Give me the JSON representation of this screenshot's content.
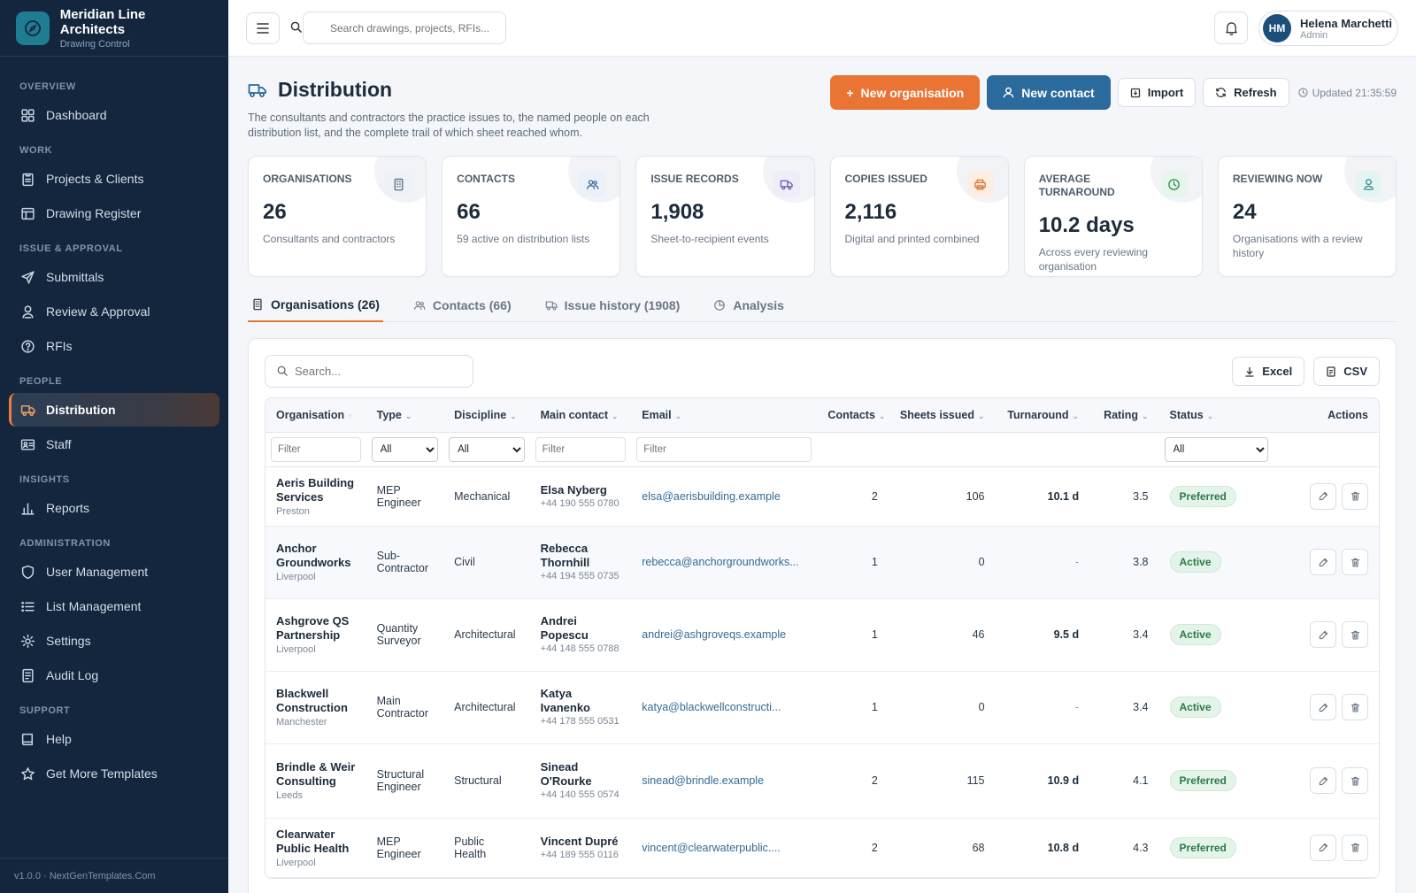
{
  "brand": {
    "title": "Meridian Line Architects",
    "subtitle": "Drawing Control"
  },
  "sidebar": {
    "sections": [
      {
        "label": "OVERVIEW",
        "items": [
          {
            "label": "Dashboard",
            "icon": "dashboard-icon"
          }
        ]
      },
      {
        "label": "WORK",
        "items": [
          {
            "label": "Projects & Clients",
            "icon": "clipboard-icon"
          },
          {
            "label": "Drawing Register",
            "icon": "register-icon"
          }
        ]
      },
      {
        "label": "ISSUE & APPROVAL",
        "items": [
          {
            "label": "Submittals",
            "icon": "send-icon"
          },
          {
            "label": "Review & Approval",
            "icon": "reviewer-icon"
          },
          {
            "label": "RFIs",
            "icon": "question-icon"
          }
        ]
      },
      {
        "label": "PEOPLE",
        "items": [
          {
            "label": "Distribution",
            "icon": "truck-icon",
            "active": true
          },
          {
            "label": "Staff",
            "icon": "id-card-icon"
          }
        ]
      },
      {
        "label": "INSIGHTS",
        "items": [
          {
            "label": "Reports",
            "icon": "bar-chart-icon"
          }
        ]
      },
      {
        "label": "ADMINISTRATION",
        "items": [
          {
            "label": "User Management",
            "icon": "shield-icon"
          },
          {
            "label": "List Management",
            "icon": "list-icon"
          },
          {
            "label": "Settings",
            "icon": "gear-icon"
          },
          {
            "label": "Audit Log",
            "icon": "log-icon"
          }
        ]
      },
      {
        "label": "SUPPORT",
        "items": [
          {
            "label": "Help",
            "icon": "book-icon"
          },
          {
            "label": "Get More Templates",
            "icon": "star-icon"
          }
        ]
      }
    ],
    "footer": "v1.0.0 · NextGenTemplates.Com"
  },
  "topbar": {
    "search_placeholder": "Search drawings, projects, RFIs...",
    "user": {
      "initials": "HM",
      "name": "Helena Marchetti",
      "role": "Admin"
    }
  },
  "page": {
    "title": "Distribution",
    "description": "The consultants and contractors the practice issues to, the named people on each distribution list, and the complete trail of which sheet reached whom.",
    "actions": {
      "new_org": "New organisation",
      "new_contact": "New contact",
      "import": "Import",
      "refresh": "Refresh",
      "updated": "Updated 21:35:59"
    }
  },
  "stats": [
    {
      "label": "ORGANISATIONS",
      "value": "26",
      "sub": "Consultants and contractors",
      "icon": "building-icon",
      "color": "#eef1f5",
      "ico_color": "#5a6f86"
    },
    {
      "label": "CONTACTS",
      "value": "66",
      "sub": "59 active on distribution lists",
      "icon": "users-icon",
      "color": "#eaf1f8",
      "ico_color": "#3b6f9e"
    },
    {
      "label": "ISSUE RECORDS",
      "value": "1,908",
      "sub": "Sheet-to-recipient events",
      "icon": "truck-icon",
      "color": "#efedf8",
      "ico_color": "#6b5fb0"
    },
    {
      "label": "COPIES ISSUED",
      "value": "2,116",
      "sub": "Digital and printed combined",
      "icon": "printer-icon",
      "color": "#fdeee4",
      "ico_color": "#e07432"
    },
    {
      "label": "AVERAGE TURNAROUND",
      "value": "10.2 days",
      "sub": "Across every reviewing organisation",
      "icon": "clock-icon",
      "color": "#e8f5ec",
      "ico_color": "#2f8b55"
    },
    {
      "label": "REVIEWING NOW",
      "value": "24",
      "sub": "Organisations with a review history",
      "icon": "reviewer-icon",
      "color": "#e5f4f3",
      "ico_color": "#2a8c88"
    }
  ],
  "tabs": [
    {
      "label": "Organisations (26)",
      "icon": "building-icon",
      "active": true
    },
    {
      "label": "Contacts (66)",
      "icon": "users-icon"
    },
    {
      "label": "Issue history (1908)",
      "icon": "truck-icon"
    },
    {
      "label": "Analysis",
      "icon": "pie-icon"
    }
  ],
  "table": {
    "search_placeholder": "Search...",
    "export": {
      "excel": "Excel",
      "csv": "CSV"
    },
    "columns": [
      {
        "label": "Organisation",
        "sort": "↑"
      },
      {
        "label": "Type",
        "sort": "⌄"
      },
      {
        "label": "Discipline",
        "sort": "⌄"
      },
      {
        "label": "Main contact",
        "sort": "⌄"
      },
      {
        "label": "Email",
        "sort": "⌄"
      },
      {
        "label": "Contacts",
        "sort": "⌄"
      },
      {
        "label": "Sheets issued",
        "sort": "⌄"
      },
      {
        "label": "Turnaround",
        "sort": "⌄"
      },
      {
        "label": "Rating",
        "sort": "⌄"
      },
      {
        "label": "Status",
        "sort": "⌄"
      },
      {
        "label": "Actions",
        "sort": ""
      }
    ],
    "filters": {
      "text": "Filter",
      "all": "All"
    },
    "rows": [
      {
        "org": "Aeris Building Services",
        "city": "Preston",
        "type": "MEP Engineer",
        "discipline": "Mechanical",
        "contact": "Elsa Nyberg",
        "phone": "+44 190 555 0780",
        "email": "elsa@aerisbuilding.example",
        "contacts": "2",
        "sheets": "106",
        "turnaround": "10.1 d",
        "rating": "3.5",
        "status": "Preferred"
      },
      {
        "org": "Anchor Groundworks",
        "city": "Liverpool",
        "type": "Sub-Contractor",
        "discipline": "Civil",
        "contact": "Rebecca Thornhill",
        "phone": "+44 194 555 0735",
        "email": "rebecca@anchorgroundworks...",
        "contacts": "1",
        "sheets": "0",
        "turnaround": "-",
        "rating": "3.8",
        "status": "Active"
      },
      {
        "org": "Ashgrove QS Partnership",
        "city": "Liverpool",
        "type": "Quantity Surveyor",
        "discipline": "Architectural",
        "contact": "Andrei Popescu",
        "phone": "+44 148 555 0788",
        "email": "andrei@ashgroveqs.example",
        "contacts": "1",
        "sheets": "46",
        "turnaround": "9.5 d",
        "rating": "3.4",
        "status": "Active"
      },
      {
        "org": "Blackwell Construction",
        "city": "Manchester",
        "type": "Main Contractor",
        "discipline": "Architectural",
        "contact": "Katya Ivanenko",
        "phone": "+44 178 555 0531",
        "email": "katya@blackwellconstructi...",
        "contacts": "1",
        "sheets": "0",
        "turnaround": "-",
        "rating": "3.4",
        "status": "Active"
      },
      {
        "org": "Brindle & Weir Consulting",
        "city": "Leeds",
        "type": "Structural Engineer",
        "discipline": "Structural",
        "contact": "Sinead O'Rourke",
        "phone": "+44 140 555 0574",
        "email": "sinead@brindle.example",
        "contacts": "2",
        "sheets": "115",
        "turnaround": "10.9 d",
        "rating": "4.1",
        "status": "Preferred"
      },
      {
        "org": "Clearwater Public Health",
        "city": "Liverpool",
        "type": "MEP Engineer",
        "discipline": "Public Health",
        "contact": "Vincent Dupré",
        "phone": "+44 189 555 0116",
        "email": "vincent@clearwaterpublic....",
        "contacts": "2",
        "sheets": "68",
        "turnaround": "10.8 d",
        "rating": "4.3",
        "status": "Preferred"
      }
    ]
  }
}
